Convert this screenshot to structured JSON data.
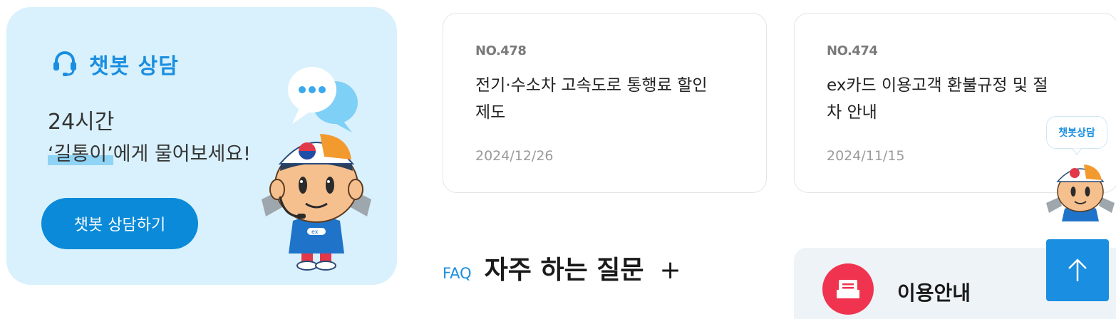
{
  "chatbot": {
    "title": "챗봇 상담",
    "line1": "24시간",
    "line2_highlight": "‘길통이’",
    "line2_rest": "에게 물어보세요!",
    "button_label": "챗봇 상담하기",
    "accent": "#1a8ee0",
    "background": "#d9f1fc"
  },
  "news": [
    {
      "no": "NO.478",
      "title": "전기·수소차 고속도로 통행료 할인제도",
      "date": "2024/12/26"
    },
    {
      "no": "NO.474",
      "title": "ex카드 이용고객 환불규정 및 절차 안내",
      "date": "2024/11/15"
    }
  ],
  "faq": {
    "tag": "FAQ",
    "heading": "자주 하는 질문",
    "plus": "+"
  },
  "guide": {
    "label": "이용안내",
    "icon": "inbox-icon",
    "icon_color": "#f0334e"
  },
  "floating_bot": {
    "bubble_text": "챗봇상담"
  },
  "to_top": {
    "icon": "arrow-up-icon",
    "color": "#1a8ee0"
  }
}
